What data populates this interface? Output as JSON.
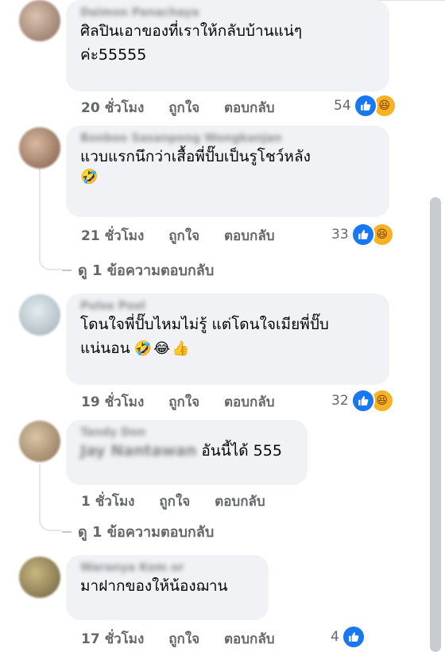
{
  "comments": [
    {
      "author": "Daimon Panachaya",
      "text": "ศิลปินเอาของที่เราให้กลับบ้านแน่ๆ\nค่ะ55555",
      "emoji": "",
      "time": "20 ชั่วโมง",
      "like": "ถูกใจ",
      "reply": "ตอบกลับ",
      "reaction_count": "54",
      "reactions": [
        "like-icon",
        "haha-icon"
      ],
      "avatar_color": "#b89a86"
    },
    {
      "author": "Bonboo Sasanpong Wongkanjan",
      "text": "แวบแรกนึกว่าเสื้อพี่ปั๊บเป็นรูโชว์หลัง",
      "emoji": "🤣",
      "time": "21 ชั่วโมง",
      "like": "ถูกใจ",
      "reply": "ตอบกลับ",
      "reaction_count": "33",
      "reactions": [
        "like-icon",
        "haha-icon"
      ],
      "avatar_color": "#a7826b",
      "view_replies": "ดู 1 ข้อความตอบกลับ"
    },
    {
      "author": "Pulse Pool",
      "text": "โดนใจพี่ปั๊บไหมไม่รู้ แต่โดนใจเมียพี่ปั๊บ\nแน่นอน",
      "emoji": "🤣😂👍",
      "time": "19 ชั่วโมง",
      "like": "ถูกใจ",
      "reply": "ตอบกลับ",
      "reaction_count": "32",
      "reactions": [
        "like-icon",
        "haha-icon"
      ],
      "avatar_color": "#c9d4d8"
    },
    {
      "author": "Tandy Don",
      "mention": "Jay Nantawan",
      "text": "อันนี้ได้ 555",
      "emoji": "",
      "time": "1 ชั่วโมง",
      "like": "ถูกใจ",
      "reply": "ตอบกลับ",
      "reaction_count": "",
      "reactions": [],
      "avatar_color": "#b29a7b",
      "view_replies": "ดู 1 ข้อความตอบกลับ"
    },
    {
      "author": "Waranya Kom or",
      "text": "มาฝากของให้น้องฌาน",
      "emoji": "",
      "time": "17 ชั่วโมง",
      "like": "ถูกใจ",
      "reply": "ตอบกลับ",
      "reaction_count": "4",
      "reactions": [
        "like-icon"
      ],
      "avatar_color": "#9c8a5f"
    }
  ],
  "colors": {
    "bubble": "#f0f2f5",
    "meta": "#65676b",
    "like_blue": "#1877f2",
    "haha_yellow": "#f7b125"
  }
}
